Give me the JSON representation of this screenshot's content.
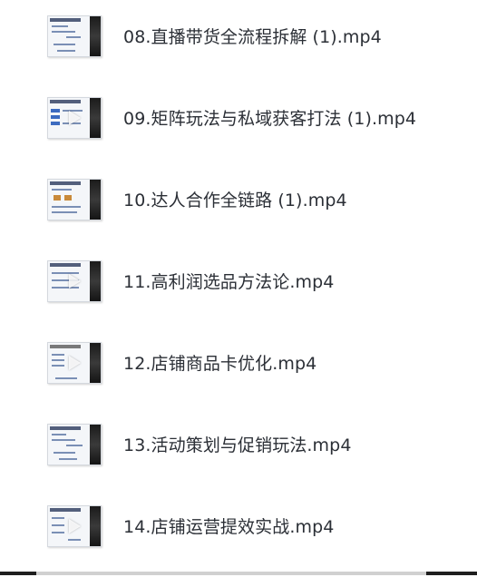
{
  "files": [
    {
      "name": "08.直播带货全流程拆解 (1).mp4",
      "thumb_icon": "video-thumbnail-icon"
    },
    {
      "name": "09.矩阵玩法与私域获客打法 (1).mp4",
      "thumb_icon": "video-thumbnail-icon"
    },
    {
      "name": "10.达人合作全链路 (1).mp4",
      "thumb_icon": "video-thumbnail-icon"
    },
    {
      "name": "11.高利润选品方法论.mp4",
      "thumb_icon": "video-thumbnail-icon"
    },
    {
      "name": "12.店铺商品卡优化.mp4",
      "thumb_icon": "video-thumbnail-icon"
    },
    {
      "name": "13.活动策划与促销玩法.mp4",
      "thumb_icon": "video-thumbnail-icon"
    },
    {
      "name": "14.店铺运营提效实战.mp4",
      "thumb_icon": "video-thumbnail-icon"
    }
  ],
  "colors": {
    "text": "#2b2f36",
    "thumbnail_accent": "#3d6bc0",
    "thumbnail_dark": "#1b1b1b"
  }
}
